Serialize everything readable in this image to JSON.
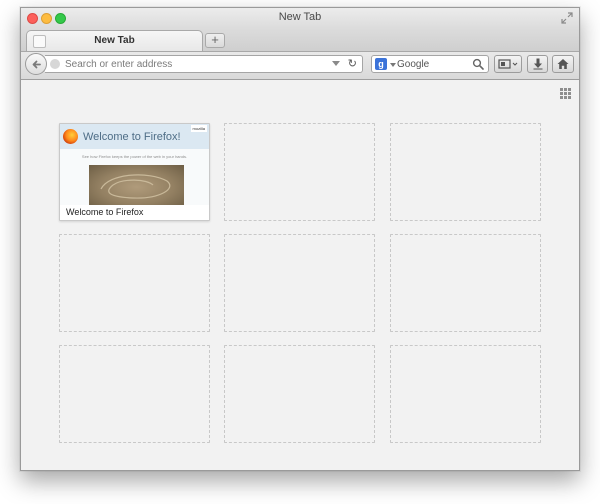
{
  "window": {
    "title": "New Tab"
  },
  "tabs": [
    {
      "label": "New Tab"
    }
  ],
  "navbar": {
    "url_placeholder": "Search or enter address",
    "search_placeholder": "Google",
    "search_engine_letter": "g"
  },
  "tiles": [
    {
      "title": "Welcome to Firefox",
      "thumbnail": {
        "heading": "Welcome to Firefox!",
        "badge": "mozilla",
        "subtext": "See how Firefox keeps the power of the web in your hands."
      }
    }
  ],
  "colors": {
    "close": "#fc605b",
    "minimize": "#fdbc40",
    "maximize": "#34c84a",
    "content_bg": "#f2f2f2"
  },
  "icons": {
    "back": "back-arrow-icon",
    "reload": "reload-icon",
    "search": "magnifier-icon",
    "bookmarks": "bookmarks-icon",
    "downloads": "download-arrow-icon",
    "home": "home-icon",
    "customize": "grid-icon"
  }
}
